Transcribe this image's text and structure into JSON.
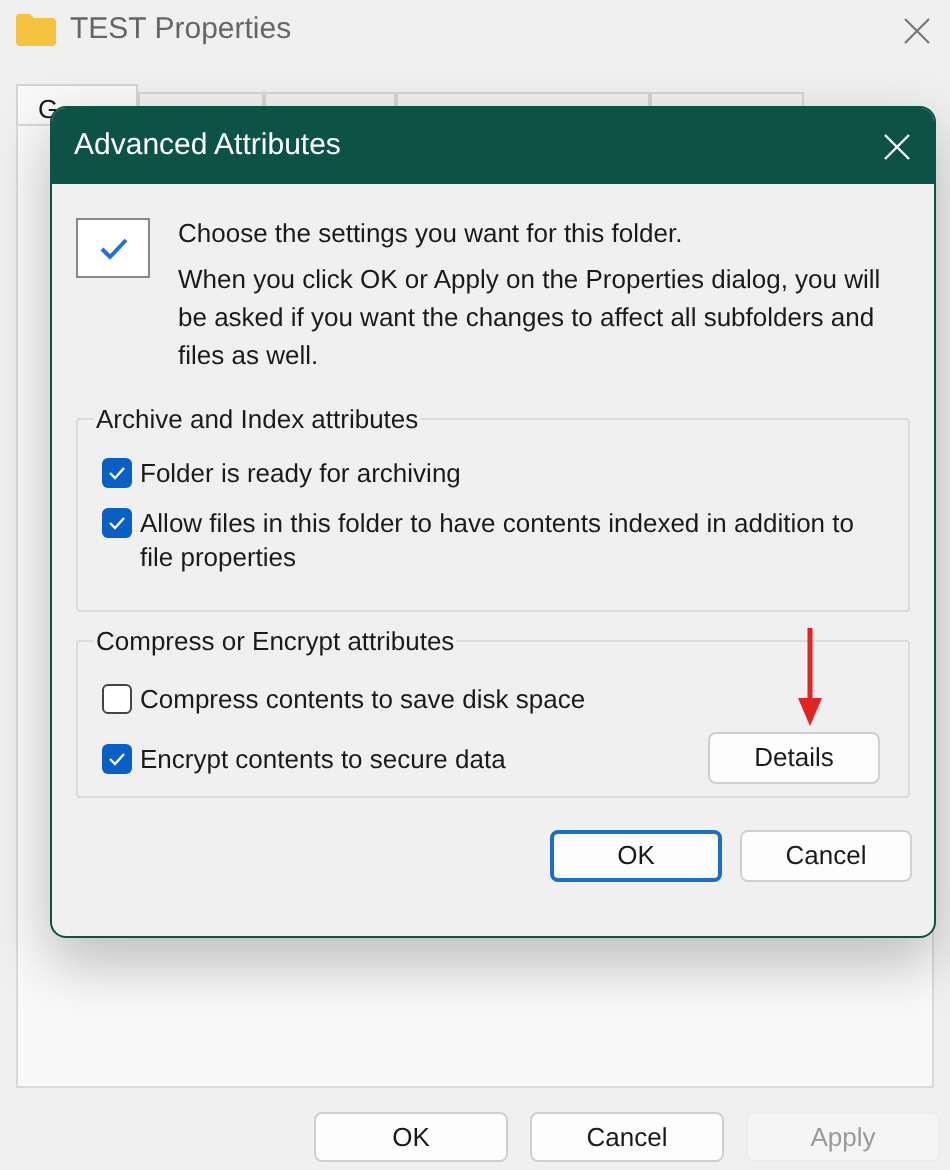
{
  "window": {
    "title": "TEST Properties"
  },
  "tabs": [
    {
      "label": "G",
      "selected": true
    },
    {
      "selected": false
    },
    {
      "selected": false
    },
    {
      "selected": false
    },
    {
      "selected": false
    }
  ],
  "dialog": {
    "title": "Advanced Attributes",
    "intro": [
      "Choose the settings you want for this folder.",
      "When you click OK or Apply on the Properties dialog, you will be asked if you want the changes to affect all subfolders and files as well."
    ],
    "groups": [
      {
        "title": "Archive and Index attributes",
        "options": [
          {
            "label": "Folder is ready for archiving",
            "checked": true
          },
          {
            "label": "Allow files in this folder to have contents indexed in addition to file properties",
            "checked": true
          }
        ]
      },
      {
        "title": "Compress or Encrypt attributes",
        "options": [
          {
            "label": "Compress contents to save disk space",
            "checked": false
          },
          {
            "label": "Encrypt contents to secure data",
            "checked": true
          }
        ],
        "button": "Details"
      }
    ],
    "buttons": [
      {
        "label": "OK",
        "default": true
      },
      {
        "label": "Cancel",
        "default": false
      }
    ]
  },
  "buttons": [
    {
      "label": "OK",
      "disabled": false
    },
    {
      "label": "Cancel",
      "disabled": false
    },
    {
      "label": "Apply",
      "disabled": true
    }
  ]
}
